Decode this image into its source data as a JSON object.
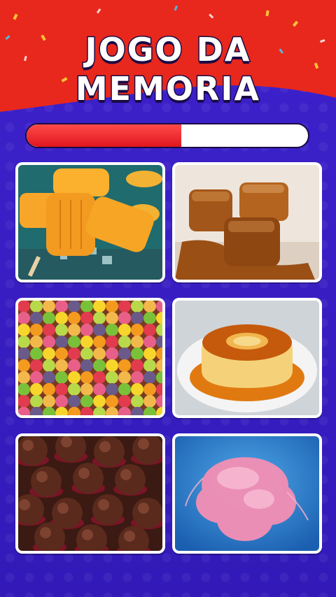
{
  "game": {
    "title_line1": "JOGO DA",
    "title_line2": "MEMORIA",
    "progress": 0.55
  },
  "colors": {
    "background": "#3a1fc7",
    "header": "#e8281c",
    "progress_fill": "#e0161e",
    "card_border": "#ffffff"
  },
  "cards": [
    {
      "name": "popsicles"
    },
    {
      "name": "caramel-candies"
    },
    {
      "name": "gumdrops"
    },
    {
      "name": "flan-pudding"
    },
    {
      "name": "brigadeiros"
    },
    {
      "name": "cotton-candy"
    }
  ]
}
